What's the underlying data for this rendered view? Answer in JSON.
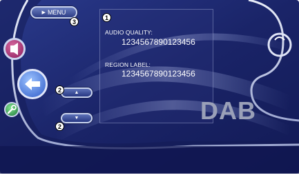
{
  "menu": {
    "label": "MENU",
    "icon": "play-triangle-icon"
  },
  "callouts": {
    "one": "1",
    "two_a": "2",
    "two_b": "2",
    "three": "3"
  },
  "info": {
    "audio_quality_label": "AUDIO QUALITY:",
    "audio_quality_value": "1234567890123456",
    "region_label_label": "REGION LABEL:",
    "region_label_value": "1234567890123456"
  },
  "scroll": {
    "up_symbol": "▲",
    "down_symbol": "▼"
  },
  "source_logo": "DAB",
  "colors": {
    "background": "#1f2a6e",
    "accent": "#c9d3ee",
    "logo": "#9aa0b8"
  }
}
